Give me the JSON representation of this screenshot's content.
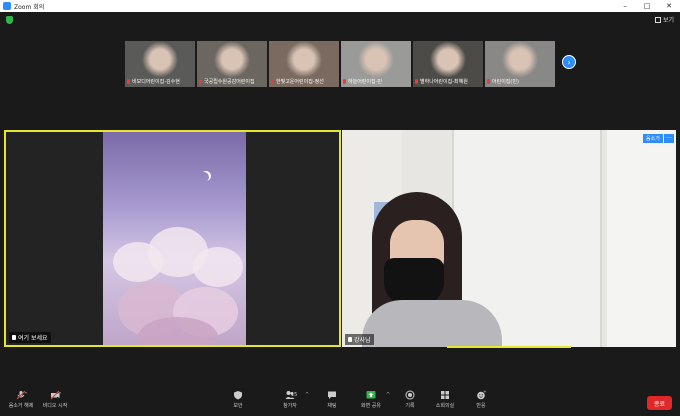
{
  "window": {
    "title": "Zoom 회의"
  },
  "topbar": {
    "view_label": "보기"
  },
  "participants_strip": [
    {
      "label": "비보디어린이집-김수현",
      "bg": "#5a5a58"
    },
    {
      "label": "국공립수원공감어린이집",
      "bg": "#6b6660"
    },
    {
      "label": "한빛고운어린이집-정선",
      "bg": "#7a6a60"
    },
    {
      "label": "하늘어린이집-민",
      "bg": "#9a9a98"
    },
    {
      "label": "별하나어린이집-최혜원",
      "bg": "#4d4b48"
    },
    {
      "label": "어린이집(민)",
      "bg": "#8a8886"
    }
  ],
  "main_video": {
    "name": "여기 보세요"
  },
  "second_video": {
    "name": "강사님"
  },
  "speaker_badge": "음소거",
  "toolbar": {
    "mute": "음소거 해제",
    "video": "비디오 시작",
    "security": "보안",
    "participants": "참가자",
    "participants_count": "15",
    "chat": "채팅",
    "share": "화면 공유",
    "record": "기록",
    "rooms": "소회의실",
    "reactions": "반응",
    "end": "종료"
  },
  "colors": {
    "accent": "#2d8cff",
    "active_speaker": "#e6e62b",
    "end": "#e02828",
    "share": "#2fb84a"
  }
}
